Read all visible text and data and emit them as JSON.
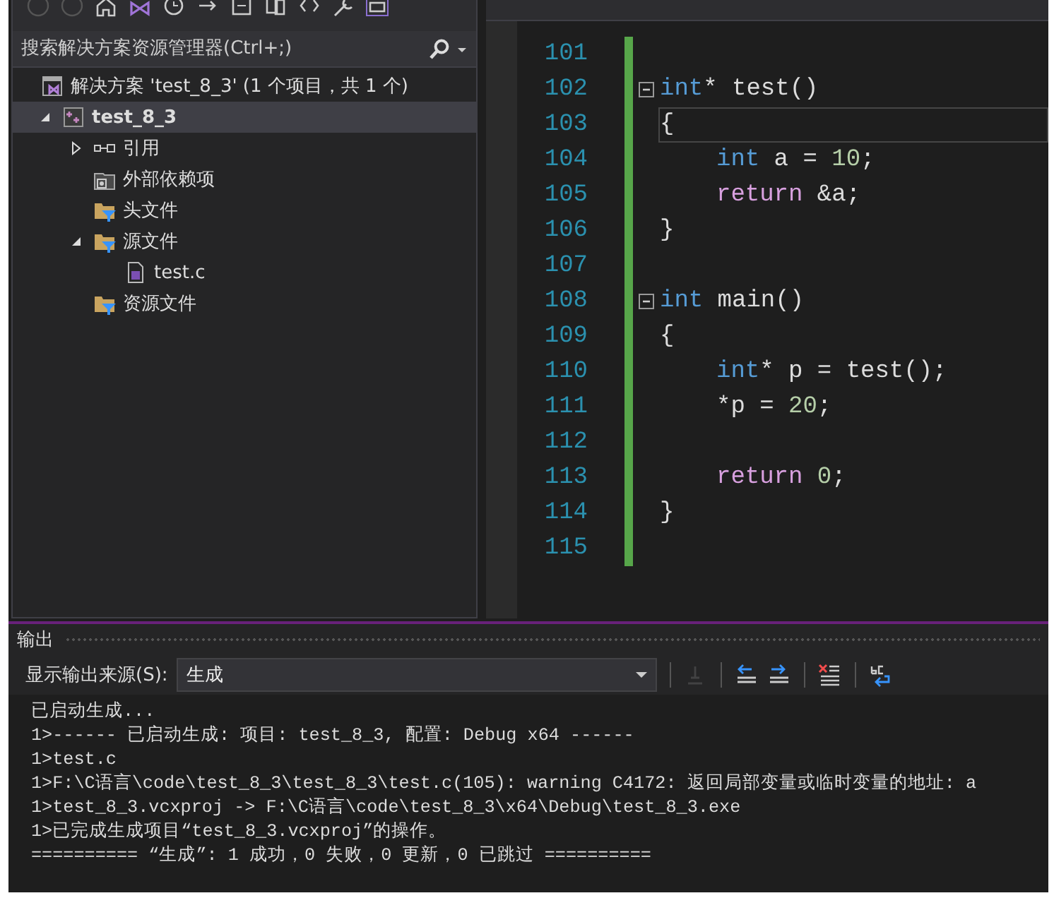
{
  "solution_explorer": {
    "search": {
      "placeholder": "搜索解决方案资源管理器(Ctrl+;)"
    },
    "tree": [
      {
        "label": "解决方案 'test_8_3' (1 个项目，共 1 个)",
        "kind": "solution",
        "selected": false,
        "children": [
          {
            "label": "test_8_3",
            "kind": "project",
            "expanded": true,
            "selected": true,
            "children": [
              {
                "label": "引用",
                "kind": "references",
                "expanded": false,
                "selected": false
              },
              {
                "label": "外部依赖项",
                "kind": "external",
                "selected": false
              },
              {
                "label": "头文件",
                "kind": "filter",
                "selected": false
              },
              {
                "label": "源文件",
                "kind": "filter",
                "expanded": true,
                "selected": false,
                "children": [
                  {
                    "label": "test.c",
                    "kind": "file",
                    "selected": false
                  }
                ]
              },
              {
                "label": "资源文件",
                "kind": "filter",
                "selected": false
              }
            ]
          }
        ]
      }
    ]
  },
  "editor": {
    "code_lines": [
      {
        "number": "101",
        "changed": true,
        "fold": false,
        "current": false
      },
      {
        "number": "102",
        "changed": true,
        "fold": true,
        "current": false,
        "indented": false,
        "tokens": [
          {
            "text": "int",
            "kind": "keyword"
          },
          {
            "text": "* test()",
            "kind": "plain"
          }
        ]
      },
      {
        "number": "103",
        "changed": true,
        "fold": false,
        "current": true,
        "indented": false,
        "tokens": [
          {
            "text": "{",
            "kind": "plain"
          }
        ]
      },
      {
        "number": "104",
        "changed": true,
        "fold": false,
        "current": false,
        "indented": true,
        "tokens": [
          {
            "text": "int",
            "kind": "keyword"
          },
          {
            "text": " a = ",
            "kind": "plain"
          },
          {
            "text": "10",
            "kind": "number"
          },
          {
            "text": ";",
            "kind": "plain"
          }
        ]
      },
      {
        "number": "105",
        "changed": true,
        "fold": false,
        "current": false,
        "indented": true,
        "tokens": [
          {
            "text": "return",
            "kind": "control"
          },
          {
            "text": " &a;",
            "kind": "plain"
          }
        ]
      },
      {
        "number": "106",
        "changed": true,
        "fold": false,
        "current": false,
        "indented": false,
        "tokens": [
          {
            "text": "}",
            "kind": "plain"
          }
        ]
      },
      {
        "number": "107",
        "changed": true,
        "fold": false,
        "current": false
      },
      {
        "number": "108",
        "changed": true,
        "fold": true,
        "current": false,
        "indented": false,
        "tokens": [
          {
            "text": "int",
            "kind": "keyword"
          },
          {
            "text": " main()",
            "kind": "plain"
          }
        ]
      },
      {
        "number": "109",
        "changed": true,
        "fold": false,
        "current": false,
        "indented": false,
        "tokens": [
          {
            "text": "{",
            "kind": "plain"
          }
        ]
      },
      {
        "number": "110",
        "changed": true,
        "fold": false,
        "current": false,
        "indented": true,
        "tokens": [
          {
            "text": "int",
            "kind": "keyword"
          },
          {
            "text": "* p = test();",
            "kind": "plain"
          }
        ]
      },
      {
        "number": "111",
        "changed": true,
        "fold": false,
        "current": false,
        "indented": true,
        "tokens": [
          {
            "text": "*p = ",
            "kind": "plain"
          },
          {
            "text": "20",
            "kind": "number"
          },
          {
            "text": ";",
            "kind": "plain"
          }
        ]
      },
      {
        "number": "112",
        "changed": true,
        "fold": false,
        "current": false
      },
      {
        "number": "113",
        "changed": true,
        "fold": false,
        "current": false,
        "indented": true,
        "tokens": [
          {
            "text": "return",
            "kind": "control"
          },
          {
            "text": " 0",
            "kind": "number"
          },
          {
            "text": ";",
            "kind": "plain"
          }
        ]
      },
      {
        "number": "114",
        "changed": true,
        "fold": false,
        "current": false,
        "indented": false,
        "tokens": [
          {
            "text": "}",
            "kind": "plain"
          }
        ]
      },
      {
        "number": "115",
        "changed": true,
        "fold": false,
        "current": false
      }
    ]
  },
  "output": {
    "title": "输出",
    "source_label": "显示输出来源(S):",
    "source_value": "生成",
    "toolbar_buttons": [
      {
        "kind": "find-source",
        "disabled": true
      },
      {
        "kind": "prev-message",
        "disabled": false
      },
      {
        "kind": "next-message",
        "disabled": false
      },
      {
        "kind": "clear",
        "disabled": false
      },
      {
        "kind": "word-wrap",
        "disabled": false
      }
    ],
    "lines": [
      "已启动生成...",
      "1>------ 已启动生成: 项目: test_8_3, 配置: Debug x64 ------",
      "1>test.c",
      "1>F:\\C语言\\code\\test_8_3\\test_8_3\\test.c(105): warning C4172: 返回局部变量或临时变量的地址: a",
      "1>test_8_3.vcxproj -> F:\\C语言\\code\\test_8_3\\x64\\Debug\\test_8_3.exe",
      "1>已完成生成项目“test_8_3.vcxproj”的操作。",
      "========== “生成”: 1 成功，0 失败，0 更新，0 已跳过 =========="
    ]
  }
}
